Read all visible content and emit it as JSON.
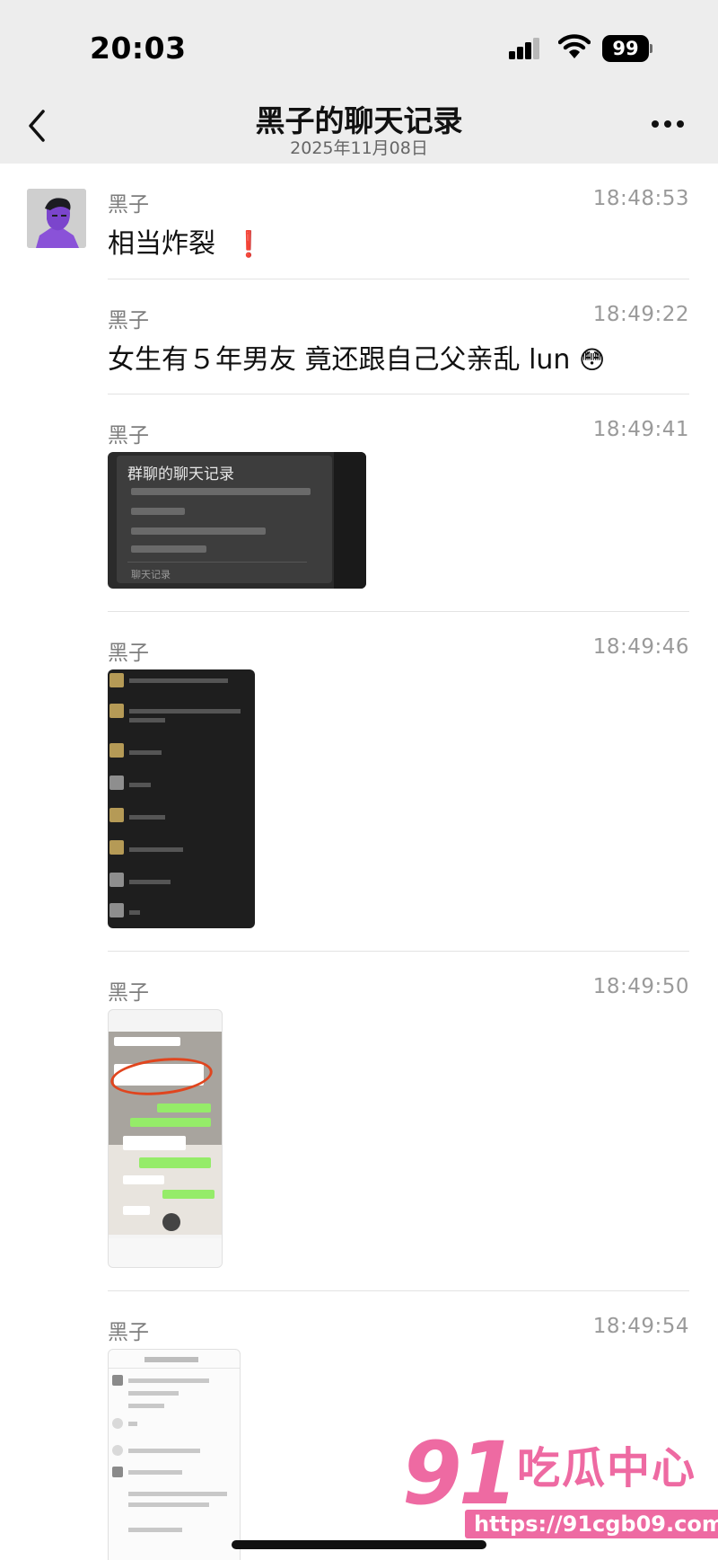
{
  "status_bar": {
    "time": "20:03",
    "battery": "99"
  },
  "header": {
    "title": "黑子的聊天记录",
    "subtitle": "2025年11月08日"
  },
  "messages": [
    {
      "sender": "黑子",
      "time": "18:48:53",
      "text": "相当炸裂",
      "emoji": "❗"
    },
    {
      "sender": "黑子",
      "time": "18:49:22",
      "text": "女生有５年男友 竟还跟自己父亲乱 lun",
      "emoji": "😳"
    },
    {
      "sender": "黑子",
      "time": "18:49:41",
      "image": {
        "title": "群聊的聊天记录",
        "footer": "聊天记录"
      }
    },
    {
      "sender": "黑子",
      "time": "18:49:46"
    },
    {
      "sender": "黑子",
      "time": "18:49:50"
    },
    {
      "sender": "黑子",
      "time": "18:49:54"
    }
  ],
  "watermark": {
    "number": "91",
    "name": "吃瓜中心",
    "url": "https://91cgb09.com"
  },
  "colors": {
    "header_bg": "#ededed",
    "watermark": "#ee6aa2",
    "chat_green": "#95ec69"
  }
}
